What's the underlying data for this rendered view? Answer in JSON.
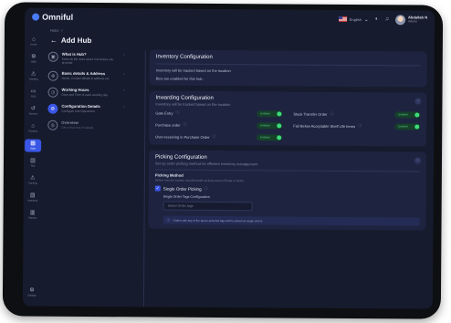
{
  "app": {
    "logo": "Omniful",
    "accent": "#3a56e6"
  },
  "topbar": {
    "language": "English",
    "user_name": "Abdullah N",
    "user_role": "Admin"
  },
  "sidebar": {
    "items": [
      {
        "label": "Home",
        "icon": "home-icon",
        "glyph": "⌂"
      },
      {
        "label": "OMS",
        "icon": "gear-icon",
        "glyph": "⚙"
      },
      {
        "label": "Tracking",
        "icon": "tracking-icon",
        "glyph": "⚠"
      },
      {
        "label": "POS",
        "icon": "pos-icon",
        "glyph": "▭"
      },
      {
        "label": "Returns",
        "icon": "returns-icon",
        "glyph": "↺"
      },
      {
        "label": "Products",
        "icon": "products-icon",
        "glyph": "⌂"
      },
      {
        "label": "Hubs",
        "icon": "hubs-icon",
        "glyph": "▦"
      },
      {
        "label": "Pay",
        "icon": "pay-icon",
        "glyph": "▤"
      },
      {
        "label": "Tracking",
        "icon": "shipping-icon",
        "glyph": "⚠"
      },
      {
        "label": "Inventory",
        "icon": "inventory-icon",
        "glyph": "▤"
      },
      {
        "label": "Reports",
        "icon": "reports-icon",
        "glyph": "▥"
      }
    ],
    "settings": {
      "label": "Settings",
      "glyph": "⚙"
    }
  },
  "header": {
    "breadcrumb": [
      "Hubs",
      "/"
    ],
    "title": "Add Hub"
  },
  "steps": [
    {
      "title": "What is Hub?",
      "desc": "Know all the more about hub before you proceed",
      "glyph": "▣",
      "state": "normal"
    },
    {
      "title": "Basic details & Address",
      "desc": "Name, Contact details & address etc.",
      "glyph": "⊕",
      "state": "normal"
    },
    {
      "title": "Working Hours",
      "desc": "Days and Time of each working day",
      "glyph": "◷",
      "state": "normal"
    },
    {
      "title": "Configuration Details",
      "desc": "Configure hub Operations",
      "glyph": "⚙",
      "state": "active"
    },
    {
      "title": "Overview",
      "desc": "Get a final look of details",
      "glyph": "◎",
      "state": "dim"
    }
  ],
  "inventory": {
    "title": "Inventory Configuration",
    "line1": "Inventory will be tracked based on the location",
    "line2": "Bins are enabled for this hub."
  },
  "inwarding": {
    "title": "Inwarding Configuration",
    "subtitle": "Inventory will be tracked based on the location",
    "options": [
      {
        "label": "Gate Entry",
        "status": "Enabled"
      },
      {
        "label": "Stock Transfer Order",
        "status": "Enabled"
      },
      {
        "label": "Purchase order",
        "status": "Enabled"
      },
      {
        "label": "Fail Below Acceptable Shelf Life Items",
        "status": "Enabled"
      },
      {
        "label": "Over-receiving in Purchase Order",
        "status": "Enabled"
      }
    ]
  },
  "picking": {
    "title": "Picking Configuration",
    "subtitle": "Set up order picking method for efficient inventory management",
    "method_label": "Picking Method",
    "method_desc": "Define how the system should handle picking orders (Single or Multi)",
    "checkbox_label": "Single Order Picking",
    "tags_label": "Single Order Tags Configuration",
    "tags_placeholder": "Select Order tags",
    "note": "Orders with any of the above-selected tags will be picked as single orders"
  }
}
